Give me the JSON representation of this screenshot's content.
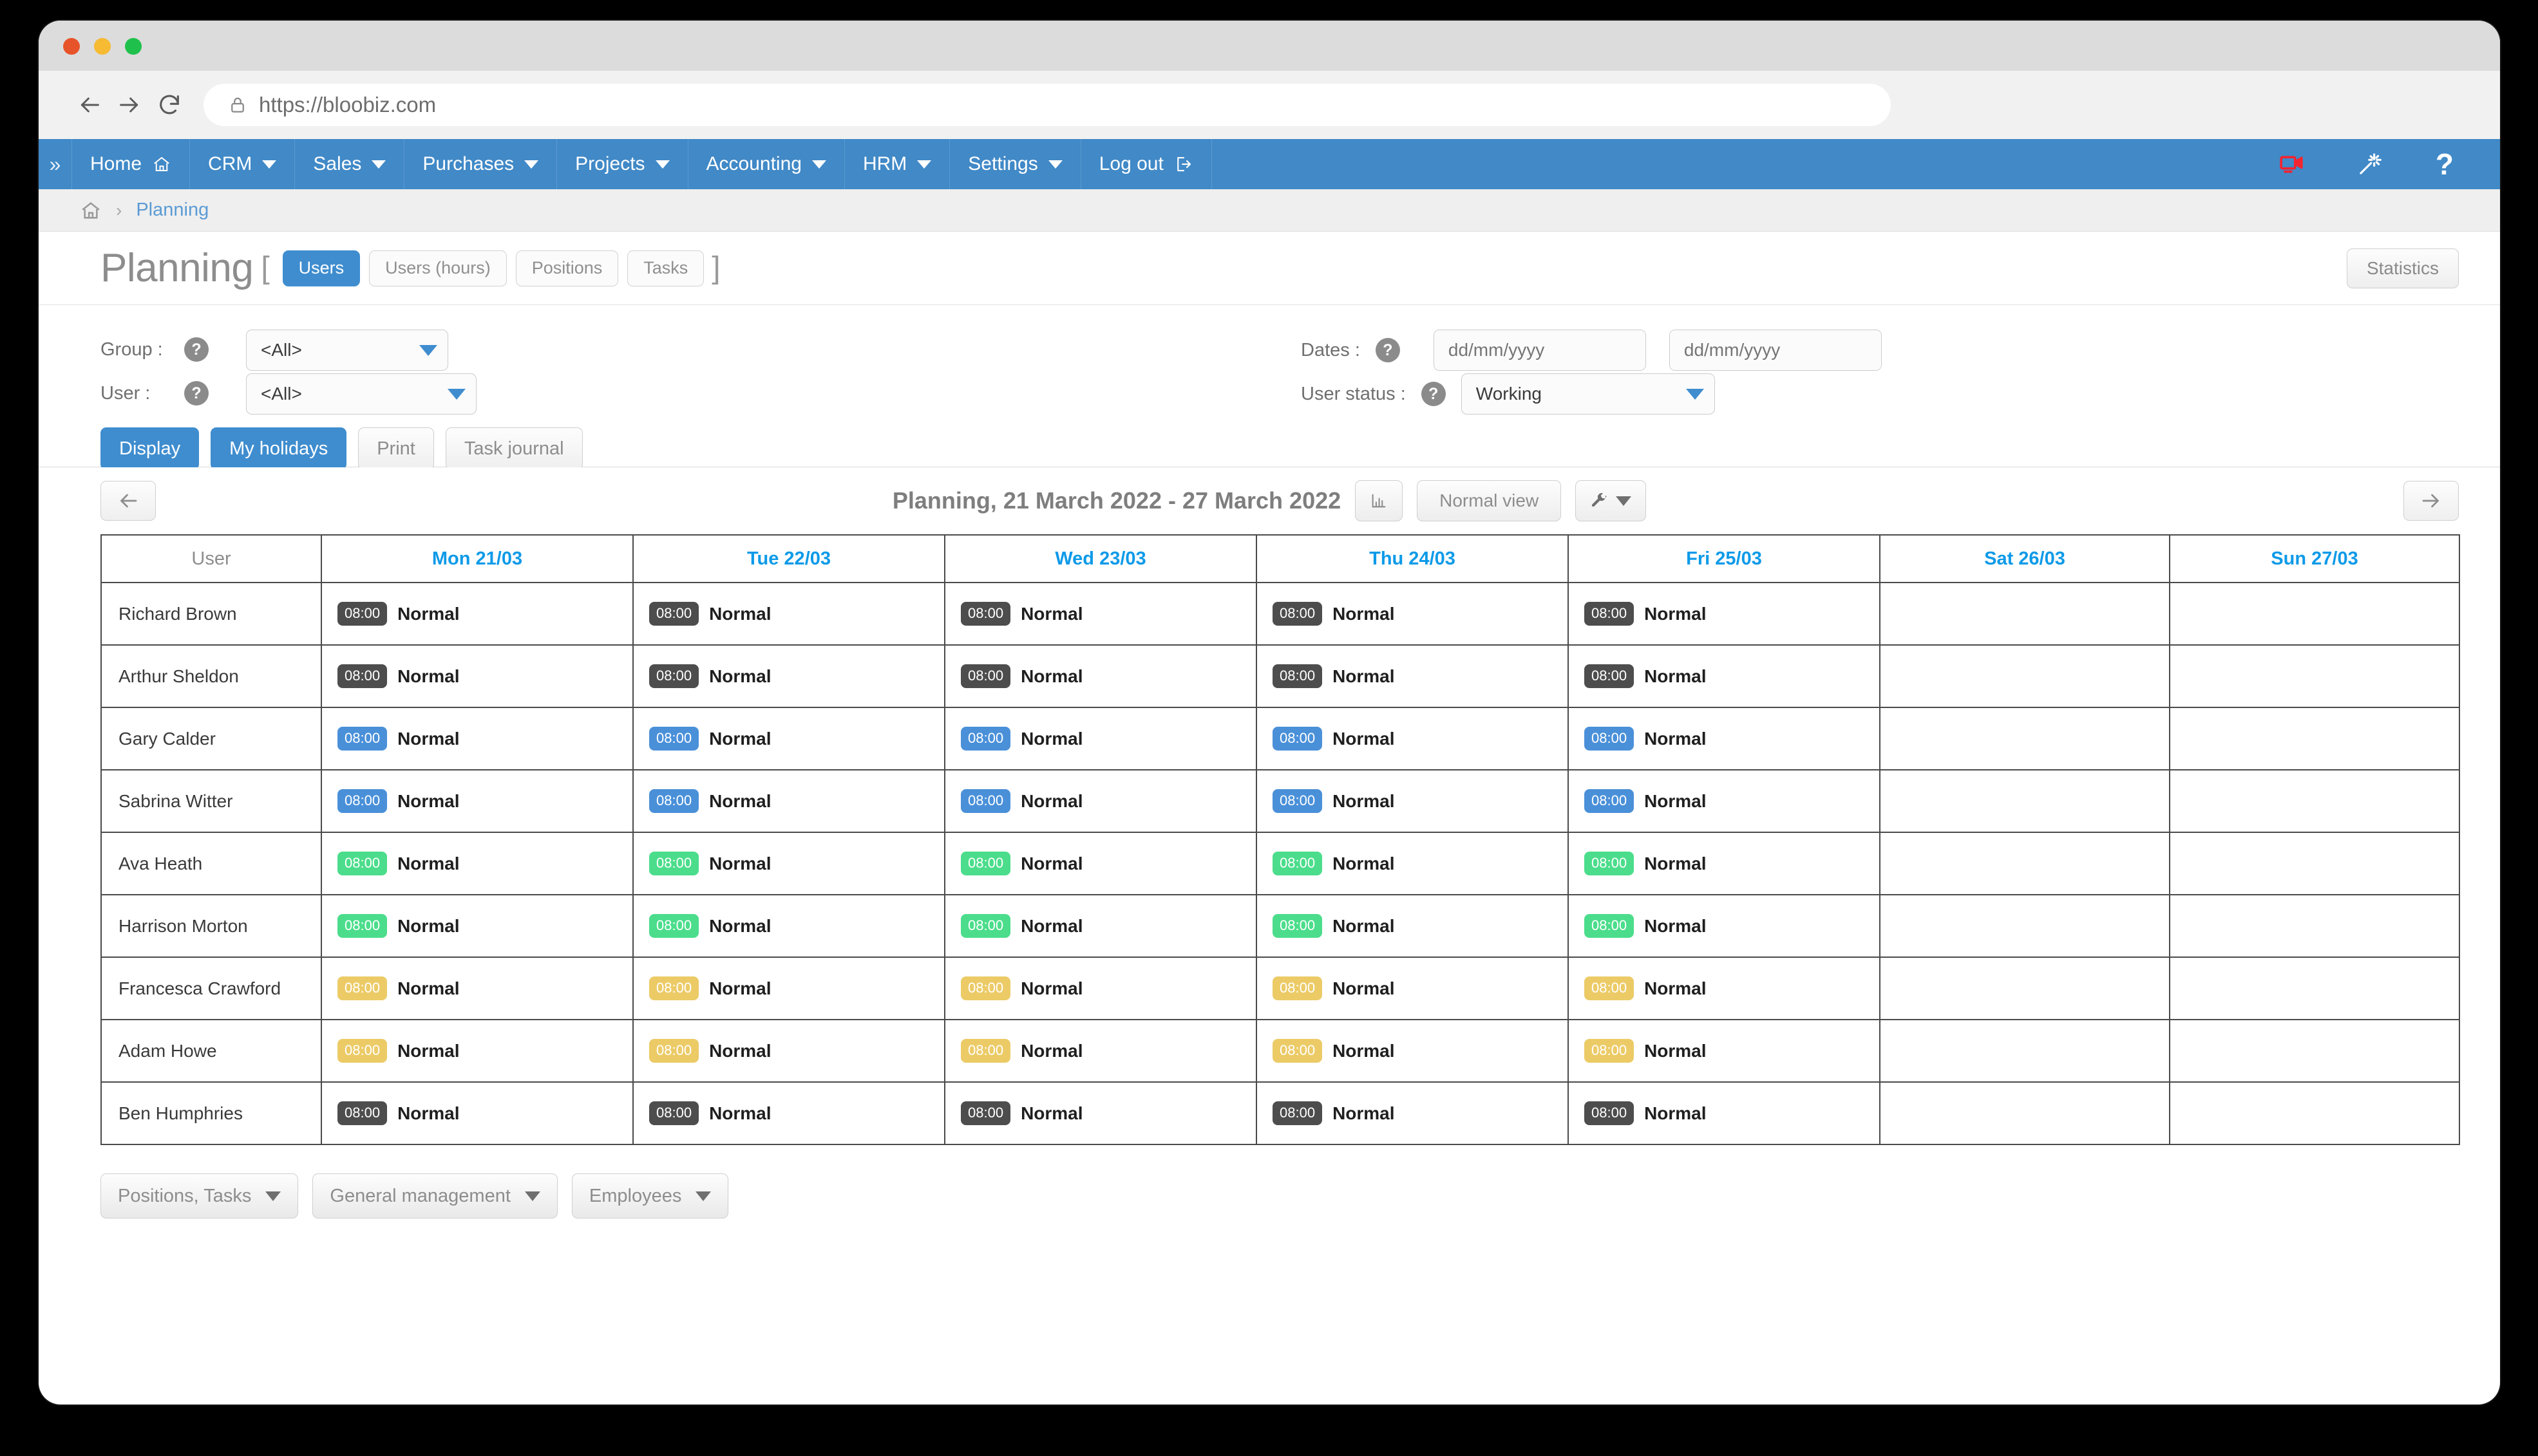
{
  "browser": {
    "url": "https://bloobiz.com",
    "lock_icon": "lock-icon",
    "back_icon": "back-arrow-icon",
    "forward_icon": "forward-arrow-icon",
    "reload_icon": "reload-icon"
  },
  "topnav": {
    "expand_icon": "double-chevron-right-icon",
    "items": [
      {
        "label": "Home",
        "icon": "home-icon",
        "caret": false
      },
      {
        "label": "CRM",
        "icon": "",
        "caret": true
      },
      {
        "label": "Sales",
        "icon": "",
        "caret": true
      },
      {
        "label": "Purchases",
        "icon": "",
        "caret": true
      },
      {
        "label": "Projects",
        "icon": "",
        "caret": true
      },
      {
        "label": "Accounting",
        "icon": "",
        "caret": true
      },
      {
        "label": "HRM",
        "icon": "",
        "caret": true
      },
      {
        "label": "Settings",
        "icon": "",
        "caret": true
      },
      {
        "label": "Log out",
        "icon": "logout-icon",
        "caret": false
      }
    ],
    "right_icons": [
      {
        "name": "video-camera-icon",
        "color": "#f42430"
      },
      {
        "name": "magic-wand-icon",
        "color": "#ffffff"
      },
      {
        "name": "help-question-icon",
        "color": "#ffffff"
      }
    ],
    "bg_color": "#4189c7"
  },
  "breadcrumb": {
    "home_icon": "home-icon",
    "separator": "›",
    "current": "Planning"
  },
  "page": {
    "title": "Planning",
    "bracket_open": "[",
    "bracket_close": "]",
    "tabs": [
      {
        "label": "Users",
        "active": true
      },
      {
        "label": "Users (hours)",
        "active": false
      },
      {
        "label": "Positions",
        "active": false
      },
      {
        "label": "Tasks",
        "active": false
      }
    ],
    "statistics_label": "Statistics"
  },
  "filters": {
    "group_label": "Group :",
    "group_value": "<All>",
    "user_label": "User :",
    "user_value": "<All>",
    "dates_label": "Dates :",
    "date_from_placeholder": "dd/mm/yyyy",
    "date_from_value": "",
    "date_to_placeholder": "dd/mm/yyyy",
    "date_to_value": "",
    "user_status_label": "User status :",
    "user_status_value": "Working",
    "help_icon": "question-mark-icon",
    "calendar_icon": "calendar-icon",
    "buttons": [
      {
        "label": "Display",
        "style": "primary"
      },
      {
        "label": "My holidays",
        "style": "primary"
      },
      {
        "label": "Print",
        "style": "light"
      },
      {
        "label": "Task journal",
        "style": "light"
      }
    ]
  },
  "planbar": {
    "prev_icon": "left-arrow-icon",
    "next_icon": "right-arrow-icon",
    "title": "Planning, 21 March 2022 - 27 March 2022",
    "chart_icon": "bar-chart-icon",
    "view_label": "Normal view",
    "tools_icon": "wrench-icon",
    "tools_caret": "caret-down-icon"
  },
  "table": {
    "columns": [
      {
        "label": "User",
        "weekend": false
      },
      {
        "label": "Mon 21/03",
        "weekend": false
      },
      {
        "label": "Tue 22/03",
        "weekend": false
      },
      {
        "label": "Wed 23/03",
        "weekend": false
      },
      {
        "label": "Thu 24/03",
        "weekend": false
      },
      {
        "label": "Fri 25/03",
        "weekend": false
      },
      {
        "label": "Sat 26/03",
        "weekend": true
      },
      {
        "label": "Sun 27/03",
        "weekend": true
      }
    ],
    "badge_colors": {
      "dark": "#4d4d4d",
      "blue": "#4a90d9",
      "green": "#4bdd8b",
      "yellow": "#eccb67"
    },
    "rows": [
      {
        "user": "Richard Brown",
        "badge": "dark",
        "time": "08:00",
        "status": "Normal"
      },
      {
        "user": "Arthur Sheldon",
        "badge": "dark",
        "time": "08:00",
        "status": "Normal"
      },
      {
        "user": "Gary Calder",
        "badge": "blue",
        "time": "08:00",
        "status": "Normal"
      },
      {
        "user": "Sabrina Witter",
        "badge": "blue",
        "time": "08:00",
        "status": "Normal"
      },
      {
        "user": "Ava Heath",
        "badge": "green",
        "time": "08:00",
        "status": "Normal"
      },
      {
        "user": "Harrison Morton",
        "badge": "green",
        "time": "08:00",
        "status": "Normal"
      },
      {
        "user": "Francesca Crawford",
        "badge": "yellow",
        "time": "08:00",
        "status": "Normal"
      },
      {
        "user": "Adam Howe",
        "badge": "yellow",
        "time": "08:00",
        "status": "Normal"
      },
      {
        "user": "Ben Humphries",
        "badge": "dark",
        "time": "08:00",
        "status": "Normal"
      }
    ]
  },
  "bottom_buttons": [
    {
      "label": "Positions, Tasks"
    },
    {
      "label": "General management"
    },
    {
      "label": "Employees"
    }
  ]
}
